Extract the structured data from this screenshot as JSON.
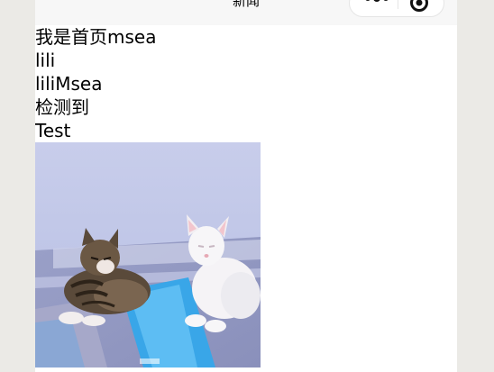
{
  "navbar": {
    "title": "新闻"
  },
  "content": {
    "lines": [
      "我是首页msea",
      "lili",
      "liliMsea",
      "检测到",
      "Test"
    ]
  },
  "image": {
    "alt": "cat-photo"
  }
}
